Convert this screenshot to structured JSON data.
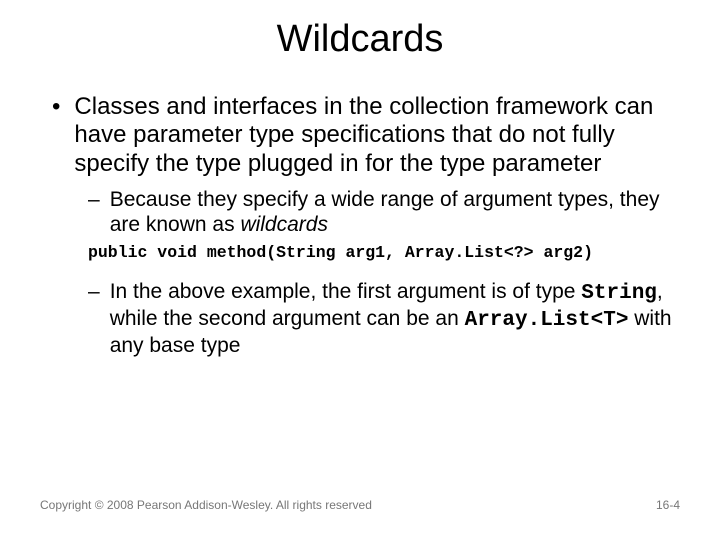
{
  "title": "Wildcards",
  "bullets": {
    "l1": "Classes and interfaces in the collection framework can have parameter type specifications that do not fully specify the type plugged in for the type parameter",
    "l2a_part1": "Because they specify a wide range of argument types, they are known as ",
    "l2a_italic": "wildcards",
    "code": "public void method(String arg1, Array.List<?> arg2)",
    "l2b_part1": "In the above example, the first argument is of type ",
    "l2b_mono1": "String",
    "l2b_part2": ", while the second argument can be an ",
    "l2b_mono2": "Array.List<T>",
    "l2b_part3": " with any base type"
  },
  "footer": {
    "copyright": "Copyright © 2008 Pearson Addison-Wesley. All rights reserved",
    "page": "16-4"
  }
}
